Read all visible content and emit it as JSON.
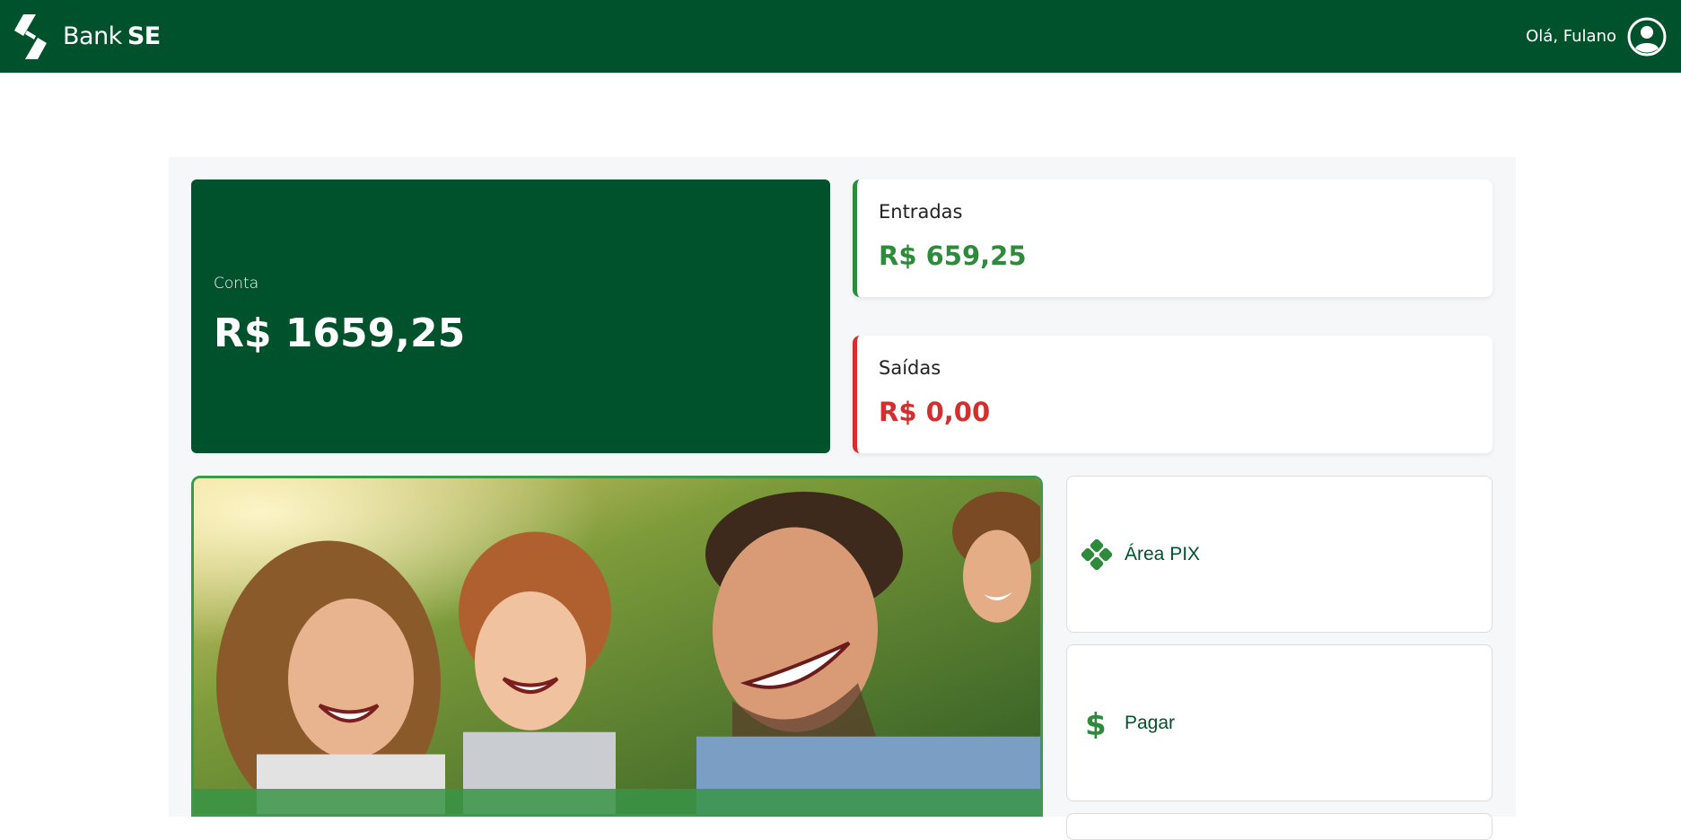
{
  "header": {
    "brand_prefix": "Bank",
    "brand_suffix": "SE",
    "greeting": "Olá, Fulano",
    "avatar_icon": "user-circle-icon",
    "logo_icon": "bank-logo-icon",
    "background_color": "#00522c"
  },
  "account": {
    "label": "Conta",
    "value": "R$ 1659,25",
    "background_color": "#00522c"
  },
  "income": {
    "label": "Entradas",
    "value": "R$ 659,25",
    "accent_color": "#2e8b3c"
  },
  "expenses": {
    "label": "Saídas",
    "value": "R$ 0,00",
    "accent_color": "#d32f2f"
  },
  "actions": [
    {
      "label": "Área PIX",
      "icon": "pix-icon"
    },
    {
      "label": "Pagar",
      "icon": "dollar-icon"
    }
  ],
  "banner": {
    "image": "family-photo"
  }
}
